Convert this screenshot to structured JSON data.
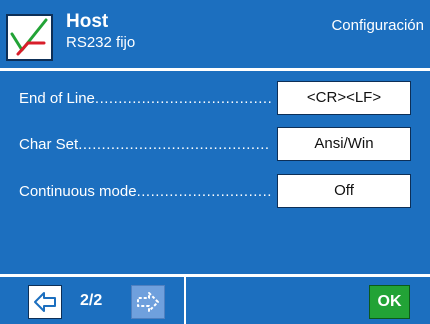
{
  "header": {
    "title": "Host",
    "subtitle": "RS232 fijo",
    "section": "Configuración",
    "logo_icon": "checkmark-pen-icon"
  },
  "settings": [
    {
      "label": "End of Line",
      "value": "<CR><LF>"
    },
    {
      "label": "Char Set",
      "value": "Ansi/Win"
    },
    {
      "label": "Continuous mode",
      "value": "Off"
    }
  ],
  "footer": {
    "page_indicator": "2/2",
    "prev_icon": "arrow-left-icon",
    "next_icon": "arrow-right-icon",
    "ok_label": "OK"
  },
  "colors": {
    "background": "#1c6fbf",
    "accent_ok": "#22a336"
  }
}
